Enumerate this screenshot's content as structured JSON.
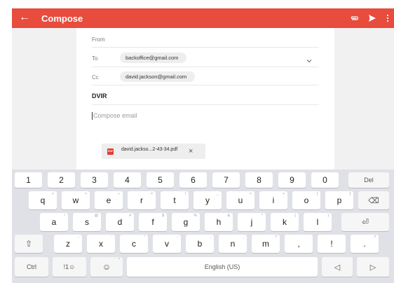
{
  "app_bar": {
    "back_icon": "←",
    "title": "Compose",
    "attach_icon": "paperclip-icon",
    "send_icon": "send-icon",
    "more_icon": "more-vertical-icon",
    "color": "#e84c3d"
  },
  "compose": {
    "from_label": "From",
    "to_label": "To",
    "to_value": "backoffice@gmail.com",
    "cc_label": "Cc",
    "cc_value": "david.jackson@gmail.com",
    "subject": "DVIR",
    "body_placeholder": "Compose email",
    "attachment": {
      "type_badge": "PDF",
      "filename": "david.jackso...2-43-34.pdf",
      "remove_icon": "×"
    }
  },
  "keyboard": {
    "row_numbers": [
      "1",
      "2",
      "3",
      "4",
      "5",
      "6",
      "7",
      "8",
      "9",
      "0"
    ],
    "del_label": "Del",
    "row1": [
      {
        "main": "q",
        "hint": "+"
      },
      {
        "main": "w",
        "hint": "×"
      },
      {
        "main": "e",
        "hint": "÷"
      },
      {
        "main": "r",
        "hint": "="
      },
      {
        "main": "t",
        "hint": "/"
      },
      {
        "main": "y",
        "hint": "_"
      },
      {
        "main": "u",
        "hint": "<"
      },
      {
        "main": "i",
        "hint": ">"
      },
      {
        "main": "o",
        "hint": "["
      },
      {
        "main": "p",
        "hint": "]"
      }
    ],
    "row2": [
      {
        "main": "a",
        "hint": "!"
      },
      {
        "main": "s",
        "hint": "@"
      },
      {
        "main": "d",
        "hint": "#"
      },
      {
        "main": "f",
        "hint": "$"
      },
      {
        "main": "g",
        "hint": "%"
      },
      {
        "main": "h",
        "hint": "&"
      },
      {
        "main": "j",
        "hint": "*"
      },
      {
        "main": "k",
        "hint": "("
      },
      {
        "main": "l",
        "hint": ")"
      }
    ],
    "row3": [
      {
        "main": "z",
        "hint": "-"
      },
      {
        "main": "x",
        "hint": "'"
      },
      {
        "main": "c",
        "hint": "\""
      },
      {
        "main": "v",
        "hint": ":"
      },
      {
        "main": "b",
        "hint": ";"
      },
      {
        "main": "n",
        "hint": ","
      },
      {
        "main": "m",
        "hint": "?"
      },
      {
        "main": ",",
        "hint": ""
      },
      {
        "main": "!",
        "hint": ""
      },
      {
        "main": ".",
        "hint": "?"
      }
    ],
    "shift_glyph": "⇧",
    "backspace_glyph": "⌫",
    "enter_glyph": "⏎",
    "ctrl_label": "Ctrl",
    "symbols_label": "!1☺",
    "emoji_glyph": "☺",
    "emoji_hint": "*",
    "space_label": "English (US)",
    "left_glyph": "◁",
    "right_glyph": "▷"
  }
}
